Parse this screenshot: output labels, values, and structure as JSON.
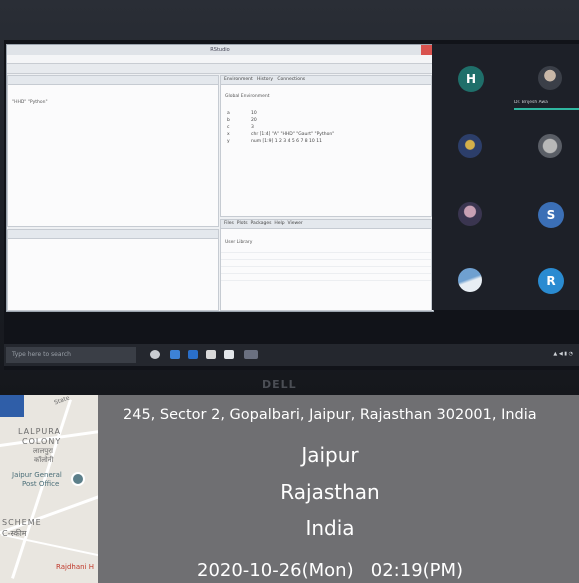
{
  "rstudio": {
    "window_title": "RStudio",
    "environment_tabs": [
      "Environment",
      "History",
      "Connections"
    ],
    "global_env": "Global Environment",
    "env_values": [
      {
        "k": "a",
        "v": "10"
      },
      {
        "k": "b",
        "v": "20"
      },
      {
        "k": "c",
        "v": "3"
      },
      {
        "k": "x",
        "v": "chr [1:4] \"A\" \"HHD\" \"Gaurt\" \"Python\""
      },
      {
        "k": "y",
        "v": "num [1:9] 1 2 3 4 5 6 7 8 10 11"
      }
    ],
    "console_snippet": "\"HHD\" \"Python\"",
    "files_tabs": [
      "Files",
      "Plots",
      "Packages",
      "Help",
      "Viewer"
    ],
    "files_header": "User Library"
  },
  "meeting": {
    "participants": [
      {
        "initial": "H",
        "color": "#1f6f6a"
      },
      {
        "initial": "S",
        "color": "#3b6fb6"
      },
      {
        "initial": "R",
        "color": "#2a8bd1"
      }
    ],
    "speaker_label": "Dr. Brijesh Awa"
  },
  "taskbar": {
    "search_placeholder": "Type here to search"
  },
  "monitor_brand": "DELL",
  "map": {
    "labels": {
      "lalpura": "LALPURA",
      "colony": "COLONY",
      "hindi_lalpura": "लालपुरा",
      "hindi_colony": "कॉलोनी",
      "post_office_1": "Jaipur General",
      "post_office_2": "Post Office",
      "scheme": "SCHEME",
      "scheme_hindi": "C-स्कीम",
      "rajdhani": "Rajdhani H",
      "state": "State"
    }
  },
  "location": {
    "address": "245, Sector 2, Gopalbari, Jaipur, Rajasthan 302001, India",
    "city": "Jaipur",
    "state": "Rajasthan",
    "country": "India",
    "timestamp": "2020-10-26(Mon)   02:19(PM)"
  }
}
